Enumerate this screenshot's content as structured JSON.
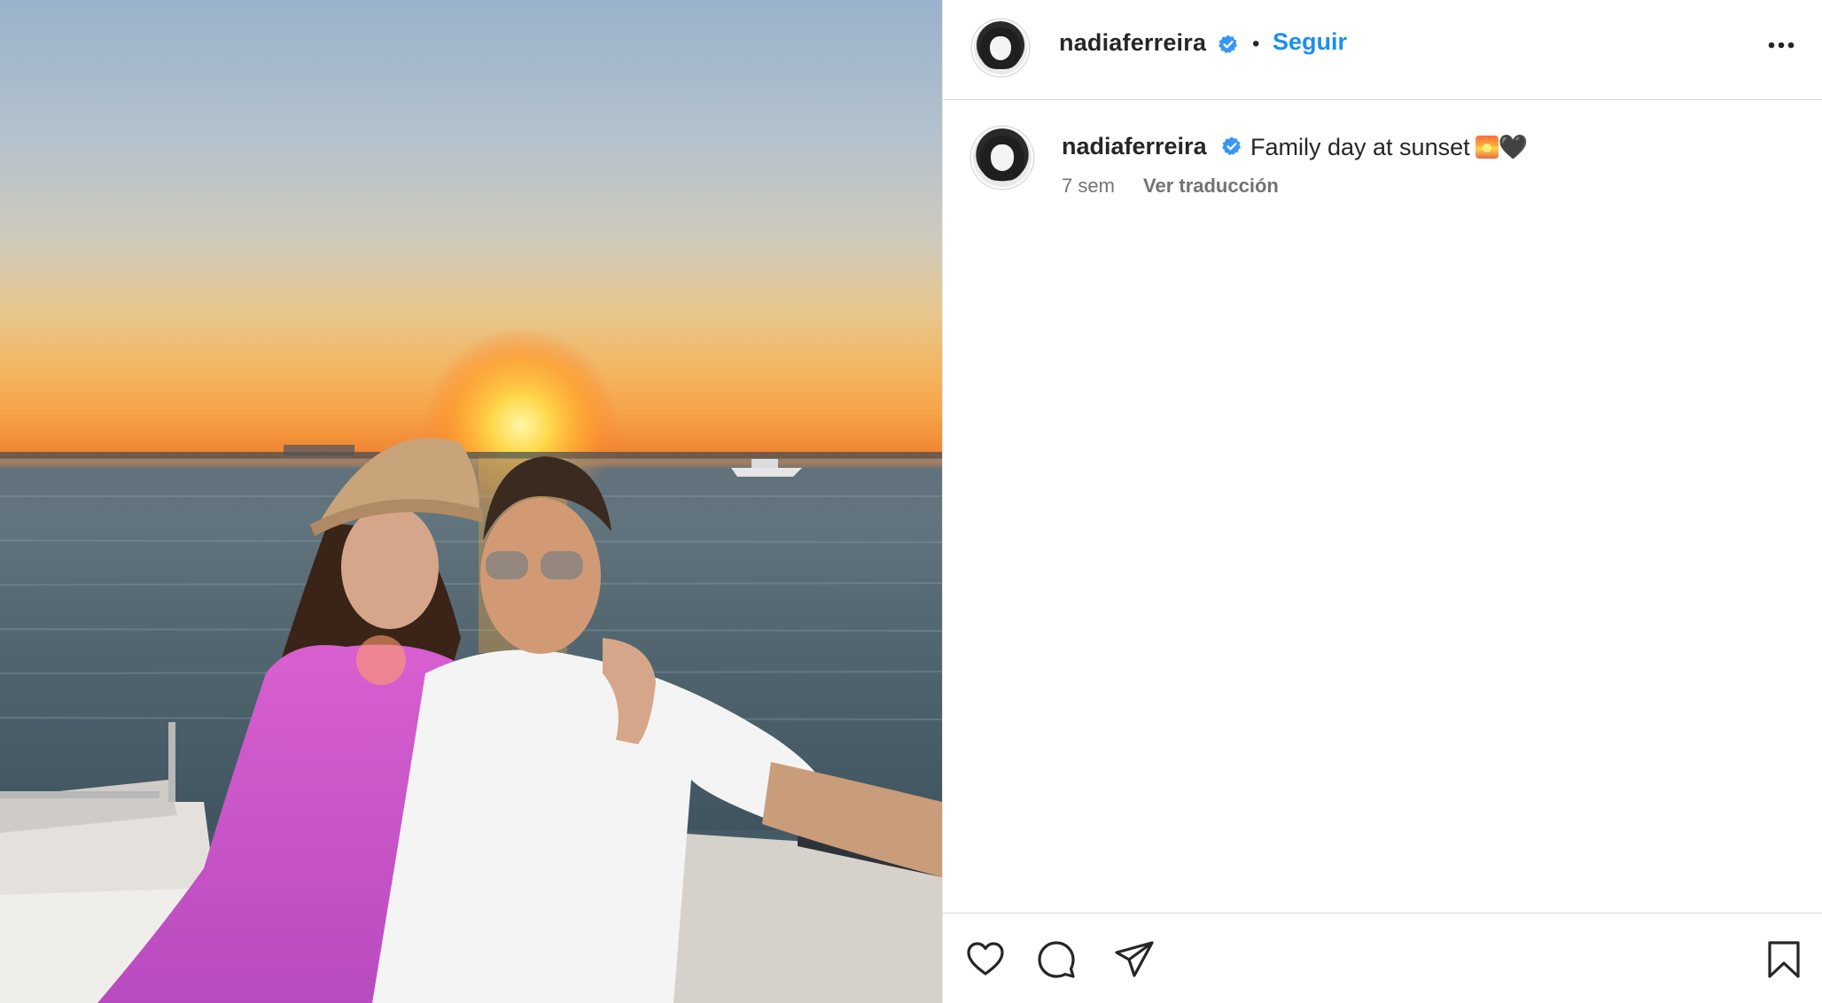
{
  "post": {
    "username": "nadiaferreira",
    "follow_label": "Seguir",
    "separator": "•",
    "caption": {
      "username": "nadiaferreira",
      "text": "Family day at sunset",
      "emoji_heart": "🖤",
      "time": "7 sem",
      "translate_label": "Ver traducción"
    }
  },
  "icons": {
    "verified": "verified-badge-icon",
    "more": "more-options-icon",
    "like": "heart-icon",
    "comment": "comment-icon",
    "share": "share-icon",
    "save": "bookmark-icon"
  },
  "colors": {
    "accent": "#1a8ff0",
    "verified": "#3897f0",
    "text": "#262626",
    "secondary_text": "#737373",
    "border": "#dbdbdb"
  }
}
